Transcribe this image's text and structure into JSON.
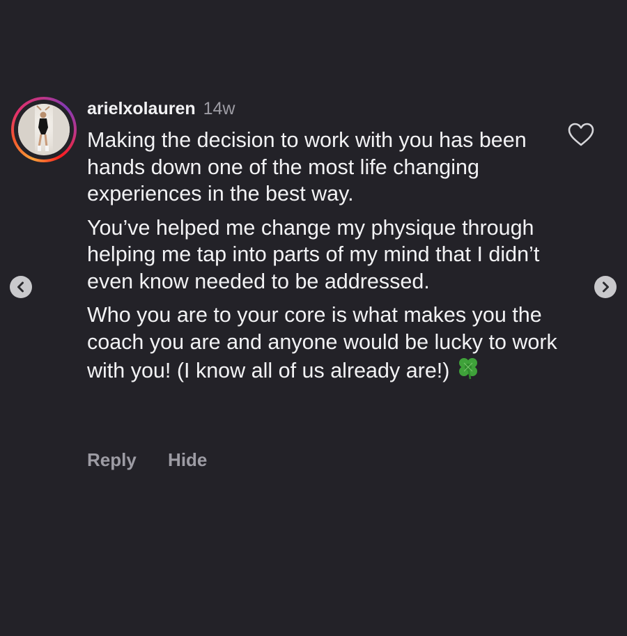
{
  "comment": {
    "username": "arielxolauren",
    "timestamp": "14w",
    "paragraphs": [
      "Making the decision to work with you has been hands down one of the most life changing experiences in the best way.",
      "You’ve helped me change my physique through helping me tap into parts of my mind that I didn’t even know needed to be addressed.",
      "Who you are to your core is what makes you the coach you are and anyone would be lucky to work with you! (I know all of us already are!)"
    ],
    "emoji": "four-leaf-clover",
    "actions": {
      "reply_label": "Reply",
      "hide_label": "Hide"
    }
  },
  "icons": {
    "like": "heart-outline-icon",
    "prev": "chevron-left-icon",
    "next": "chevron-right-icon"
  },
  "colors": {
    "background": "#232228",
    "text": "#f2f2f4",
    "muted": "#9d9ca4",
    "clover": "#3fa23a"
  }
}
